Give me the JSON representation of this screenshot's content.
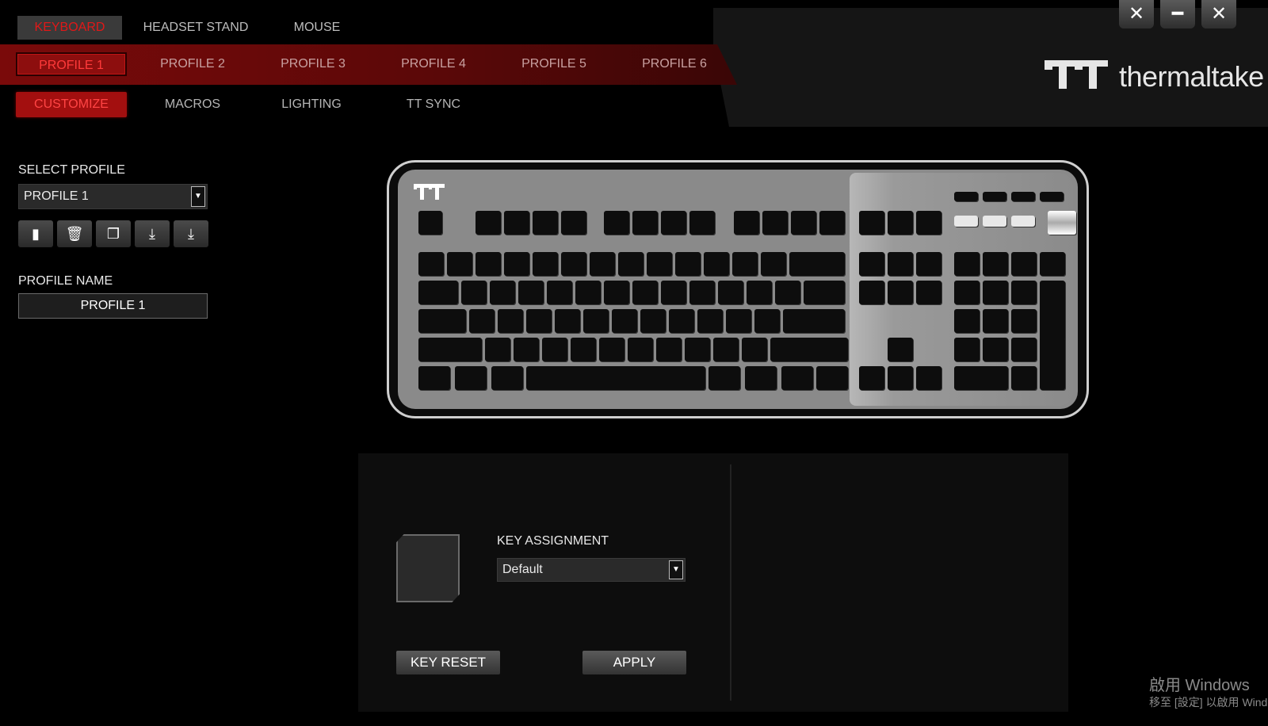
{
  "device_tabs": [
    "KEYBOARD",
    "HEADSET STAND",
    "MOUSE"
  ],
  "profile_tabs": [
    "PROFILE 1",
    "PROFILE 2",
    "PROFILE 3",
    "PROFILE 4",
    "PROFILE 5",
    "PROFILE 6"
  ],
  "sub_tabs": [
    "CUSTOMIZE",
    "MACROS",
    "LIGHTING",
    "TT SYNC"
  ],
  "brand": {
    "logo_text": "thermaltake"
  },
  "window_controls": {
    "tools": "tools-icon",
    "minimize": "minimize-icon",
    "close": "close-icon"
  },
  "left_panel": {
    "select_profile_label": "SELECT PROFILE",
    "selected_profile": "PROFILE 1",
    "profile_name_label": "PROFILE NAME",
    "profile_name_value": "PROFILE 1",
    "tool_icons": [
      "save-icon",
      "trash-icon",
      "copy-icon",
      "import-icon",
      "export-icon"
    ]
  },
  "bottom_panel": {
    "key_assignment_label": "KEY ASSIGNMENT",
    "key_assignment_value": "Default",
    "key_reset_label": "KEY RESET",
    "apply_label": "APPLY"
  },
  "watermark": {
    "line1": "啟用 Windows",
    "line2": "移至 [設定] 以啟用 Windows"
  },
  "colors": {
    "accent": "#e01818",
    "profile_bar": "#7a0a0a",
    "background": "#000000"
  }
}
